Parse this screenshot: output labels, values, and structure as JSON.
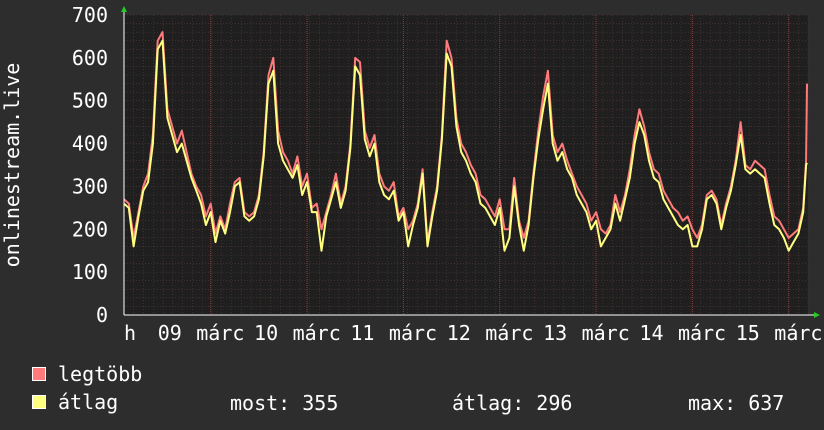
{
  "chart_data": {
    "type": "line",
    "ylabel": "onlinestream.live",
    "ylim": [
      0,
      700
    ],
    "yticks": [
      0,
      100,
      200,
      300,
      400,
      500,
      600,
      700
    ],
    "xlim": [
      0,
      7.1
    ],
    "xtick_labels": [
      {
        "x": 0.0,
        "label": "h"
      },
      {
        "x": 0.35,
        "label": "09"
      },
      {
        "x": 0.75,
        "label": "márc"
      },
      {
        "x": 1.35,
        "label": "10"
      },
      {
        "x": 1.75,
        "label": "márc"
      },
      {
        "x": 2.35,
        "label": "11"
      },
      {
        "x": 2.75,
        "label": "márc"
      },
      {
        "x": 3.35,
        "label": "12"
      },
      {
        "x": 3.75,
        "label": "márc"
      },
      {
        "x": 4.35,
        "label": "13"
      },
      {
        "x": 4.75,
        "label": "márc"
      },
      {
        "x": 5.35,
        "label": "14"
      },
      {
        "x": 5.75,
        "label": "márc"
      },
      {
        "x": 6.35,
        "label": "15"
      },
      {
        "x": 6.75,
        "label": "márc"
      }
    ],
    "day_lines": [
      0.9,
      1.9,
      2.9,
      3.9,
      4.9,
      5.9,
      6.9
    ],
    "grid": true,
    "colors": {
      "max": "#ff7b7b",
      "avg": "#ffff80",
      "background": "#2d2d2d",
      "plot": "#1f1f1f",
      "grid": "#5a3b3b",
      "day_line": "#8a3b3b",
      "axis": "#ffffff",
      "arrow": "#22cc22"
    },
    "series": [
      {
        "name": "legtöbb",
        "key": "max",
        "color": "#ff7b7b",
        "x": [
          0,
          0.05,
          0.1,
          0.15,
          0.2,
          0.25,
          0.3,
          0.35,
          0.4,
          0.45,
          0.5,
          0.55,
          0.6,
          0.65,
          0.7,
          0.75,
          0.8,
          0.85,
          0.9,
          0.95,
          1.0,
          1.05,
          1.1,
          1.15,
          1.2,
          1.25,
          1.3,
          1.35,
          1.4,
          1.45,
          1.5,
          1.55,
          1.6,
          1.65,
          1.7,
          1.75,
          1.8,
          1.85,
          1.9,
          1.95,
          2.0,
          2.05,
          2.1,
          2.15,
          2.2,
          2.25,
          2.3,
          2.35,
          2.4,
          2.45,
          2.5,
          2.55,
          2.6,
          2.65,
          2.7,
          2.75,
          2.8,
          2.85,
          2.9,
          2.95,
          3.0,
          3.05,
          3.1,
          3.15,
          3.2,
          3.25,
          3.3,
          3.35,
          3.4,
          3.45,
          3.5,
          3.55,
          3.6,
          3.65,
          3.7,
          3.75,
          3.8,
          3.85,
          3.9,
          3.95,
          4.0,
          4.05,
          4.1,
          4.15,
          4.2,
          4.25,
          4.3,
          4.35,
          4.4,
          4.45,
          4.5,
          4.55,
          4.6,
          4.65,
          4.7,
          4.75,
          4.8,
          4.85,
          4.9,
          4.95,
          5.0,
          5.05,
          5.1,
          5.15,
          5.2,
          5.25,
          5.3,
          5.35,
          5.4,
          5.45,
          5.5,
          5.55,
          5.6,
          5.65,
          5.7,
          5.75,
          5.8,
          5.85,
          5.9,
          5.95,
          6.0,
          6.05,
          6.1,
          6.15,
          6.2,
          6.25,
          6.3,
          6.35,
          6.4,
          6.45,
          6.5,
          6.55,
          6.6,
          6.65,
          6.7,
          6.75,
          6.8,
          6.85,
          6.9,
          6.95,
          7.0,
          7.05,
          7.08,
          7.09
        ],
        "values": [
          270,
          260,
          180,
          240,
          300,
          330,
          420,
          640,
          660,
          480,
          440,
          400,
          430,
          380,
          330,
          300,
          280,
          230,
          260,
          190,
          230,
          200,
          260,
          310,
          320,
          240,
          230,
          240,
          280,
          380,
          560,
          600,
          430,
          380,
          360,
          330,
          370,
          300,
          330,
          250,
          260,
          200,
          240,
          280,
          330,
          260,
          300,
          400,
          600,
          590,
          430,
          390,
          420,
          330,
          300,
          290,
          310,
          230,
          250,
          200,
          220,
          260,
          340,
          170,
          240,
          300,
          420,
          640,
          600,
          460,
          400,
          380,
          350,
          330,
          280,
          270,
          250,
          230,
          270,
          200,
          200,
          320,
          220,
          180,
          220,
          330,
          430,
          510,
          570,
          420,
          380,
          400,
          360,
          330,
          300,
          280,
          260,
          220,
          240,
          200,
          190,
          210,
          280,
          240,
          280,
          340,
          420,
          480,
          440,
          380,
          340,
          330,
          290,
          270,
          250,
          240,
          220,
          230,
          200,
          180,
          210,
          280,
          290,
          270,
          210,
          260,
          300,
          360,
          450,
          350,
          340,
          360,
          350,
          340,
          280,
          230,
          220,
          200,
          180,
          190,
          200,
          250,
          360,
          540
        ]
      },
      {
        "name": "átlag",
        "key": "avg",
        "color": "#ffff80",
        "x": [
          0,
          0.05,
          0.1,
          0.15,
          0.2,
          0.25,
          0.3,
          0.35,
          0.4,
          0.45,
          0.5,
          0.55,
          0.6,
          0.65,
          0.7,
          0.75,
          0.8,
          0.85,
          0.9,
          0.95,
          1.0,
          1.05,
          1.1,
          1.15,
          1.2,
          1.25,
          1.3,
          1.35,
          1.4,
          1.45,
          1.5,
          1.55,
          1.6,
          1.65,
          1.7,
          1.75,
          1.8,
          1.85,
          1.9,
          1.95,
          2.0,
          2.05,
          2.1,
          2.15,
          2.2,
          2.25,
          2.3,
          2.35,
          2.4,
          2.45,
          2.5,
          2.55,
          2.6,
          2.65,
          2.7,
          2.75,
          2.8,
          2.85,
          2.9,
          2.95,
          3.0,
          3.05,
          3.1,
          3.15,
          3.2,
          3.25,
          3.3,
          3.35,
          3.4,
          3.45,
          3.5,
          3.55,
          3.6,
          3.65,
          3.7,
          3.75,
          3.8,
          3.85,
          3.9,
          3.95,
          4.0,
          4.05,
          4.1,
          4.15,
          4.2,
          4.25,
          4.3,
          4.35,
          4.4,
          4.45,
          4.5,
          4.55,
          4.6,
          4.65,
          4.7,
          4.75,
          4.8,
          4.85,
          4.9,
          4.95,
          5.0,
          5.05,
          5.1,
          5.15,
          5.2,
          5.25,
          5.3,
          5.35,
          5.4,
          5.45,
          5.5,
          5.55,
          5.6,
          5.65,
          5.7,
          5.75,
          5.8,
          5.85,
          5.9,
          5.95,
          6.0,
          6.05,
          6.1,
          6.15,
          6.2,
          6.25,
          6.3,
          6.35,
          6.4,
          6.45,
          6.5,
          6.55,
          6.6,
          6.65,
          6.7,
          6.75,
          6.8,
          6.85,
          6.9,
          6.95,
          7.0,
          7.05,
          7.08,
          7.09
        ],
        "values": [
          260,
          250,
          160,
          230,
          290,
          310,
          400,
          620,
          640,
          460,
          420,
          380,
          400,
          360,
          320,
          290,
          260,
          210,
          240,
          170,
          220,
          190,
          240,
          300,
          310,
          230,
          220,
          230,
          270,
          370,
          540,
          570,
          400,
          360,
          340,
          320,
          350,
          280,
          310,
          240,
          240,
          150,
          230,
          270,
          310,
          250,
          290,
          390,
          580,
          560,
          410,
          370,
          400,
          310,
          280,
          270,
          290,
          220,
          240,
          160,
          210,
          250,
          330,
          160,
          230,
          290,
          410,
          610,
          580,
          440,
          380,
          360,
          330,
          310,
          260,
          250,
          230,
          210,
          250,
          150,
          180,
          300,
          210,
          150,
          210,
          320,
          410,
          480,
          540,
          400,
          360,
          380,
          340,
          320,
          280,
          260,
          240,
          200,
          220,
          160,
          180,
          200,
          260,
          220,
          270,
          320,
          400,
          450,
          420,
          360,
          320,
          310,
          270,
          250,
          230,
          210,
          200,
          210,
          160,
          160,
          200,
          270,
          280,
          260,
          200,
          250,
          290,
          350,
          420,
          340,
          330,
          340,
          330,
          320,
          260,
          210,
          200,
          180,
          150,
          170,
          190,
          240,
          350,
          355
        ]
      }
    ]
  },
  "legend": {
    "items": [
      {
        "label": "legtöbb",
        "color": "#ff7b7b"
      },
      {
        "label": "átlag",
        "color": "#ffff80"
      }
    ]
  },
  "stats": {
    "most": "most: 355",
    "atlag": "átlag: 296",
    "max": "max: 637"
  }
}
